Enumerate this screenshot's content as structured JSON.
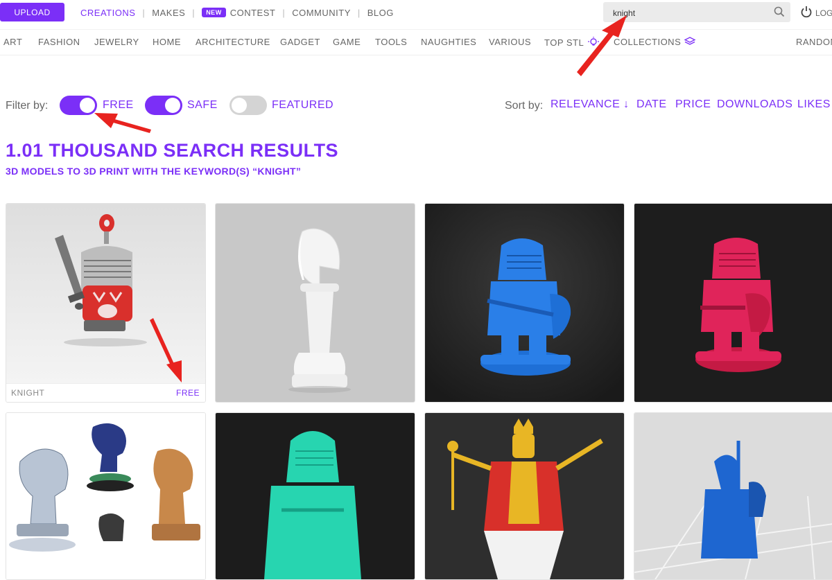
{
  "header": {
    "upload_label": "UPLOAD",
    "nav": [
      {
        "label": "CREATIONS"
      },
      {
        "label": "MAKES"
      },
      {
        "label": "CONTEST",
        "badge": "NEW"
      },
      {
        "label": "COMMUNITY"
      },
      {
        "label": "BLOG"
      }
    ],
    "search_value": "knight",
    "login_label": "LOG"
  },
  "categories": [
    "ART",
    "FASHION",
    "JEWELRY",
    "HOME",
    "ARCHITECTURE",
    "GADGET",
    "GAME",
    "TOOLS",
    "NAUGHTIES",
    "VARIOUS",
    "TOP STL",
    "COLLECTIONS",
    "RANDOM"
  ],
  "filters": {
    "label": "Filter by:",
    "toggles": [
      {
        "label": "FREE",
        "on": true
      },
      {
        "label": "SAFE",
        "on": true
      },
      {
        "label": "FEATURED",
        "on": false
      }
    ]
  },
  "sort": {
    "label": "Sort by:",
    "options": [
      "RELEVANCE ↓",
      "DATE",
      "PRICE",
      "DOWNLOADS",
      "LIKES"
    ]
  },
  "results": {
    "title": "1.01 THOUSAND SEARCH RESULTS",
    "subtitle": "3D MODELS TO 3D PRINT WITH THE KEYWORD(S) “KNIGHT”"
  },
  "cards": [
    {
      "name": "KNIGHT",
      "price": "FREE"
    }
  ],
  "colors": {
    "accent": "#7b2ff7",
    "arrow": "#e8231f"
  }
}
